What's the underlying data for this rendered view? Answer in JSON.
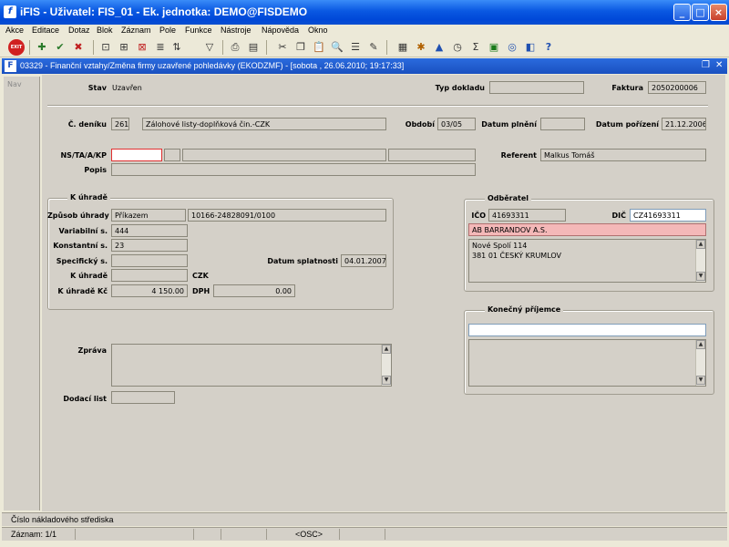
{
  "window": {
    "title": "iFIS - Uživatel: FIS_01 - Ek. jednotka: DEMO@FISDEMO",
    "icon": "f"
  },
  "menu": [
    "Akce",
    "Editace",
    "Dotaz",
    "Blok",
    "Záznam",
    "Pole",
    "Funkce",
    "Nástroje",
    "Nápověda",
    "Okno"
  ],
  "toolbar": {
    "exit_label": "EXIT"
  },
  "form": {
    "title": "03329 - Finanční vztahy/Změna firmy uzavřené pohledávky (EKODZMF) - [sobota , 26.06.2010; 19:17:33]",
    "nav_label": "Nav"
  },
  "header": {
    "stav_label": "Stav",
    "stav_value": "Uzavřen",
    "typ_dokladu_label": "Typ dokladu",
    "typ_dokladu_value": "",
    "faktura_label": "Faktura",
    "faktura_value": "2050200006"
  },
  "denik": {
    "label": "Č. deníku",
    "number": "261",
    "name": "Zálohové listy-doplňková čin.-CZK",
    "obdobi_label": "Období",
    "obdobi_value": "03/05",
    "datum_plneni_label": "Datum plnění",
    "datum_plneni_value": "",
    "datum_porizeni_label": "Datum pořízení",
    "datum_porizeni_value": "21.12.2006"
  },
  "ns": {
    "label": "NS/TA/A/KP",
    "v1": "",
    "v2": "",
    "v3": "",
    "v4": "",
    "referent_label": "Referent",
    "referent_value": "Malkus Tomáš",
    "popis_label": "Popis",
    "popis_value": ""
  },
  "k_uhrade": {
    "title": "K úhradě",
    "zpusob_label": "Způsob úhrady",
    "zpusob_value": "Příkazem",
    "account": "10166-24828091/0100",
    "var_label": "Variabilní s.",
    "var_value": "444",
    "konst_label": "Konstantní s.",
    "konst_value": "23",
    "spec_label": "Specifický s.",
    "spec_value": "",
    "datum_splatnosti_label": "Datum splatnosti",
    "datum_splatnosti_value": "04.01.2007",
    "kuhrade_label": "K úhradě",
    "kuhrade_value": "",
    "currency": "CZK",
    "kuhrade_kc_label": "K úhradě Kč",
    "kuhrade_kc_value": "4 150.00",
    "dph_label": "DPH",
    "dph_value": "0.00"
  },
  "odberatel": {
    "title": "Odběratel",
    "ico_label": "IČO",
    "ico_value": "41693311",
    "dic_label": "DIČ",
    "dic_value": "CZ41693311",
    "name": "AB BARRANDOV A.S.",
    "address_line1": "Nové Spolí 114",
    "address_line2": "381 01 ČESKÝ KRUMLOV"
  },
  "konecny": {
    "title": "Konečný příjemce",
    "name": "",
    "address": ""
  },
  "zprava": {
    "label": "Zpráva",
    "value": ""
  },
  "dodaci": {
    "label": "Dodací list",
    "value": ""
  },
  "status": {
    "hint": "Číslo nákladového střediska",
    "record": "Záznam: 1/1",
    "osc": "<OSC>"
  }
}
